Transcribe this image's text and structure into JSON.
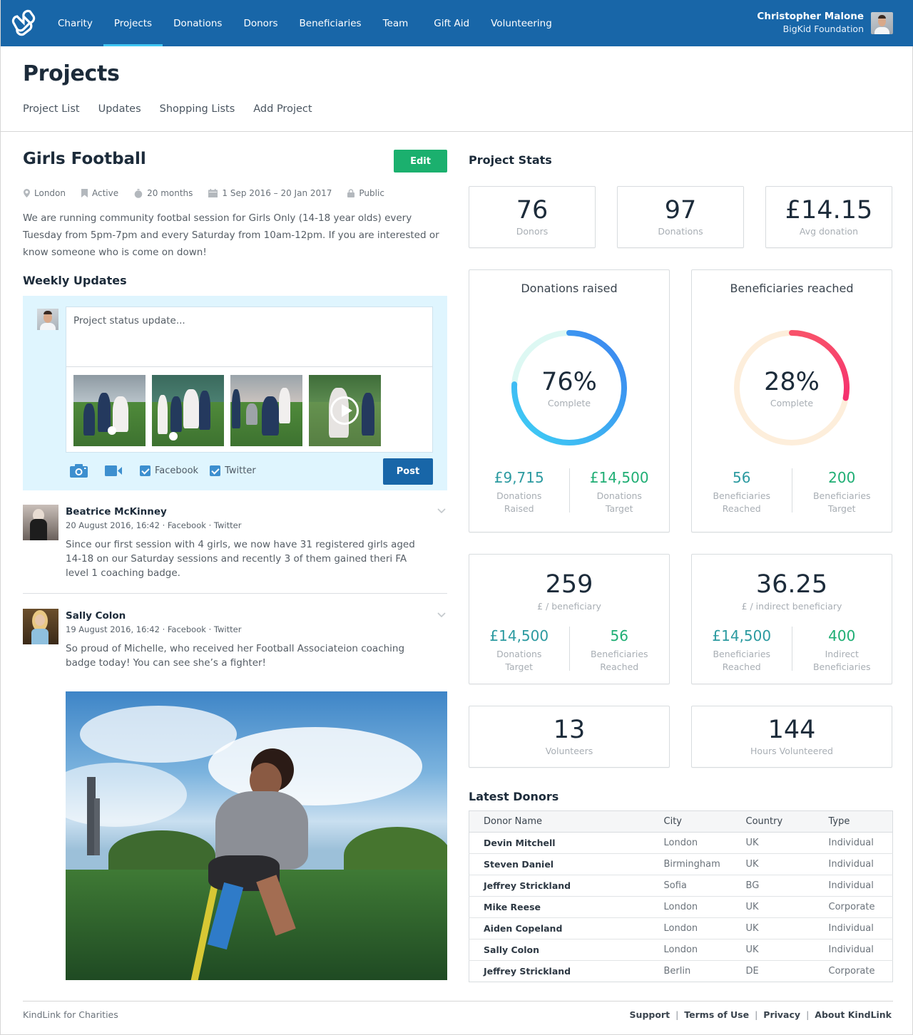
{
  "app": {
    "nav": [
      "Charity",
      "Projects",
      "Donations",
      "Donors",
      "Beneficiaries",
      "Team",
      "Gift Aid",
      "Volunteering"
    ],
    "active_nav": "Projects",
    "user": {
      "name": "Christopher Malone",
      "org": "BigKid Foundation"
    }
  },
  "page": {
    "title": "Projects",
    "subnav": [
      "Project List",
      "Updates",
      "Shopping Lists",
      "Add Project"
    ]
  },
  "project": {
    "title": "Girls Football",
    "edit_label": "Edit",
    "meta": [
      {
        "icon": "map-pin-icon",
        "text": "London"
      },
      {
        "icon": "bookmark-icon",
        "text": "Active"
      },
      {
        "icon": "stopwatch-icon",
        "text": "20 months"
      },
      {
        "icon": "calendar-icon",
        "text": "1 Sep 2016 – 20 Jan 2017"
      },
      {
        "icon": "lock-icon",
        "text": "Public"
      }
    ],
    "description": "We are running community footbal session for Girls Only (14-18 year olds) every Tuesday from 5pm-7pm and every Saturday from 10am-12pm. If you are interested or know someone who is come on down!"
  },
  "weekly_updates": {
    "heading": "Weekly Updates",
    "composer": {
      "placeholder": "Project status update...",
      "facebook_label": "Facebook",
      "twitter_label": "Twitter",
      "facebook_checked": true,
      "twitter_checked": true,
      "post_label": "Post"
    },
    "updates": [
      {
        "author": "Beatrice McKinney",
        "meta": "20 August 2016, 16:42 · Facebook · Twitter",
        "text": "Since our first session with 4 girls, we now have 31 registered girls aged 14-18 on our Saturday sessions and recently 3 of them gained theri FA level 1 coaching badge."
      },
      {
        "author": "Sally Colon",
        "meta": "19 August 2016, 16:42 · Facebook · Twitter",
        "text": "So proud of Michelle, who received her Football Associateion coaching badge today! You can see she’s a fighter!"
      }
    ]
  },
  "stats": {
    "heading": "Project Stats",
    "kpis": [
      {
        "value": "76",
        "label": "Donors"
      },
      {
        "value": "97",
        "label": "Donations"
      },
      {
        "value": "£14.15",
        "label": "Avg donation"
      }
    ],
    "donations_ring": {
      "title": "Donations raised",
      "percent": 76,
      "percent_label": "76%",
      "sub": "Complete",
      "left": {
        "value": "£9,715",
        "label": "Donations Raised"
      },
      "right": {
        "value": "£14,500",
        "label": "Donations Target"
      },
      "colors": {
        "track": "#ddf8f3",
        "start": "#3fd0f5",
        "end": "#3b82ef"
      }
    },
    "beneficiaries_ring": {
      "title": "Beneficiaries reached",
      "percent": 28,
      "percent_label": "28%",
      "sub": "Complete",
      "left": {
        "value": "56",
        "label": "Beneficiaries Reached"
      },
      "right": {
        "value": "200",
        "label": "Beneficiaries Target"
      },
      "colors": {
        "track": "#fdeedb",
        "start": "#f8526a",
        "end": "#f5306f"
      }
    },
    "per_beneficiary": {
      "value": "259",
      "label": "£ / beneficiary",
      "left": {
        "value": "£14,500",
        "label": "Donations Target"
      },
      "right": {
        "value": "56",
        "label": "Beneficiaries Reached"
      }
    },
    "per_indirect": {
      "value": "36.25",
      "label": "£ / indirect beneficiary",
      "left": {
        "value": "£14,500",
        "label": "Beneficiaries Reached"
      },
      "right": {
        "value": "400",
        "label": "Indirect Beneficiaries"
      }
    },
    "volunteers": {
      "value": "13",
      "label": "Volunteers"
    },
    "hours": {
      "value": "144",
      "label": "Hours Volunteered"
    }
  },
  "latest_donors": {
    "heading": "Latest Donors",
    "columns": [
      "Donor Name",
      "City",
      "Country",
      "Type"
    ],
    "rows": [
      [
        "Devin Mitchell",
        "London",
        "UK",
        "Individual"
      ],
      [
        "Steven Daniel",
        "Birmingham",
        "UK",
        "Individual"
      ],
      [
        "Jeffrey Strickland",
        "Sofia",
        "BG",
        "Individual"
      ],
      [
        "Mike Reese",
        "London",
        "UK",
        "Corporate"
      ],
      [
        "Aiden Copeland",
        "London",
        "UK",
        "Individual"
      ],
      [
        "Sally Colon",
        "London",
        "UK",
        "Individual"
      ],
      [
        "Jeffrey Strickland",
        "Berlin",
        "DE",
        "Corporate"
      ]
    ]
  },
  "footer": {
    "left": "KindLink for Charities",
    "links": [
      "Support",
      "Terms of Use",
      "Privacy",
      "About KindLink"
    ]
  },
  "colors": {
    "brand": "#1866a8",
    "active_tab": "#3fc6f3",
    "edit_green": "#1bb06e",
    "teal_value": "#2b9aa0",
    "green_value": "#1fae74"
  }
}
